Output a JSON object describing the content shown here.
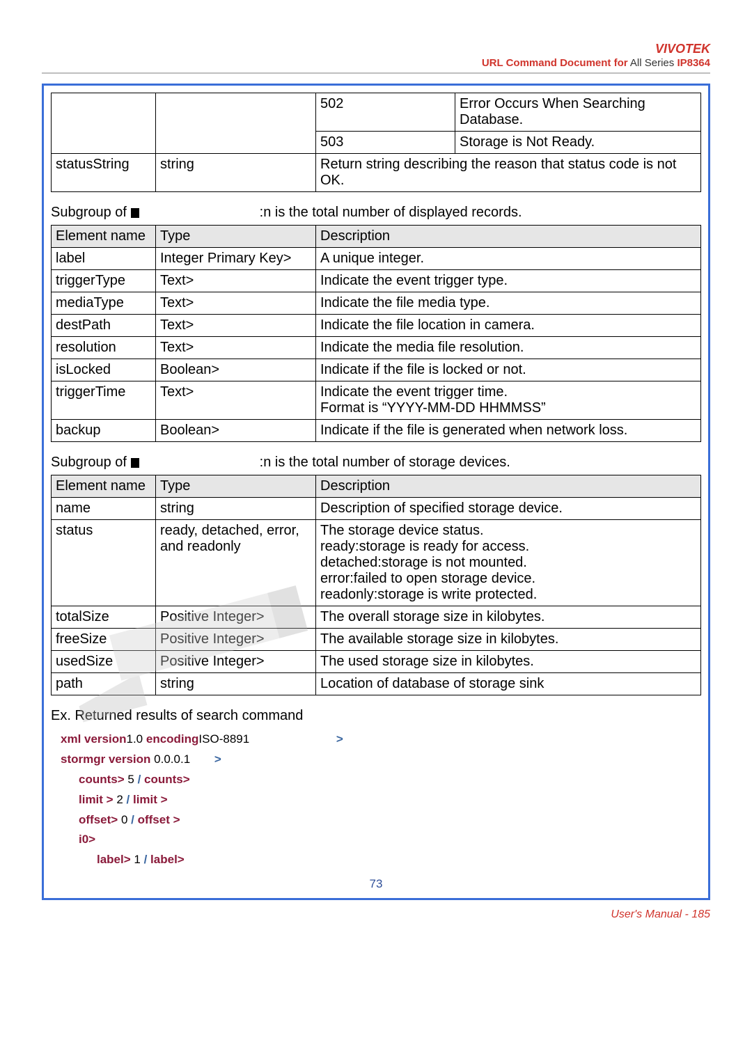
{
  "header": {
    "brand": "VIVOTEK",
    "doc_title_a": "URL Command Document for",
    "doc_title_b": "  All Series",
    "doc_title_c": "IP8364"
  },
  "table1": {
    "rows": [
      {
        "c1": "",
        "c2": "",
        "c3": "502",
        "c4": "Error Occurs When Searching Database."
      },
      {
        "c1": "",
        "c2": "",
        "c3": "503",
        "c4": "Storage is Not Ready."
      },
      {
        "c1": "statusString",
        "c2": "string",
        "c3": "Return string describing the reason that status code is not OK.",
        "c4": ""
      }
    ]
  },
  "caption2_a": "Subgroup of ",
  "caption2_b": ":n is the total number of displayed records.",
  "table2": {
    "head": [
      "Element name",
      "Type",
      "Description"
    ],
    "rows": [
      {
        "c1": "label",
        "c2": "Integer Primary Key>",
        "c3": "A unique integer."
      },
      {
        "c1": "triggerType",
        "c2": "Text>",
        "c3": "Indicate the event trigger type."
      },
      {
        "c1": "mediaType",
        "c2": "Text>",
        "c3": "Indicate the file media type."
      },
      {
        "c1": "destPath",
        "c2": " Text>",
        "c3": "Indicate the file location in camera."
      },
      {
        "c1": "resolution",
        "c2": "Text>",
        "c3": "Indicate the media file resolution."
      },
      {
        "c1": "isLocked",
        "c2": "Boolean>",
        "c3": "Indicate if the file is locked or not."
      },
      {
        "c1": "triggerTime",
        "c2": "Text>",
        "c3": "Indicate the event trigger time.\nFormat is “YYYY-MM-DD HHMMSS”"
      },
      {
        "c1": "backup",
        "c2": "Boolean>",
        "c3": "Indicate if the file is generated when network loss."
      }
    ]
  },
  "caption3_a": "Subgroup of ",
  "caption3_b": ":n is the total number of storage devices.",
  "table3": {
    "head": [
      "Element name",
      "Type",
      "Description"
    ],
    "rows": [
      {
        "c1": "name",
        "c2": "string",
        "c3": "Description of specified storage device."
      },
      {
        "c1": "status",
        "c2": "ready, detached, error, and readonly",
        "c3": "The storage device status.\nready:storage is ready for access.\ndetached:storage is not mounted.\nerror:failed to open storage device.\nreadonly:storage is write protected."
      },
      {
        "c1": "totalSize",
        "c2": "Positive Integer>",
        "c3": " The overall storage size in kilobytes."
      },
      {
        "c1": "freeSize",
        "c2": "Positive Integer>",
        "c3": " The available storage size in kilobytes."
      },
      {
        "c1": "usedSize",
        "c2": "Positive Integer>",
        "c3": " The used storage size in kilobytes."
      },
      {
        "c1": "path",
        "c2": "string",
        "c3": "Location of database of storage sink"
      }
    ]
  },
  "example_caption": "Ex. Returned results of search command",
  "xml": {
    "l1_pre": "xml version",
    "l1_v1": "1.0",
    "l1_mid": " encoding",
    "l1_v2": "ISO-8891",
    "l1_end": ">",
    "l2_tag": "stormgr version",
    "l2_val": "0.0.0.1",
    "l2_end": ">",
    "l3_open": "counts>",
    "l3_val": " 5 ",
    "l3_slash": "/",
    "l3_close": "counts>",
    "l4_open": "limit >",
    "l4_val": " 2 ",
    "l4_slash": "/",
    "l4_close": "limit >",
    "l5_open": "offset>",
    "l5_val": " 0 ",
    "l5_slash": "/",
    "l5_close": "offset >",
    "l6": "i0>",
    "l7_open": "label>",
    "l7_val": " 1 ",
    "l7_slash": "/",
    "l7_close": "label>"
  },
  "page_num": "73",
  "footer": "User's Manual - 185"
}
